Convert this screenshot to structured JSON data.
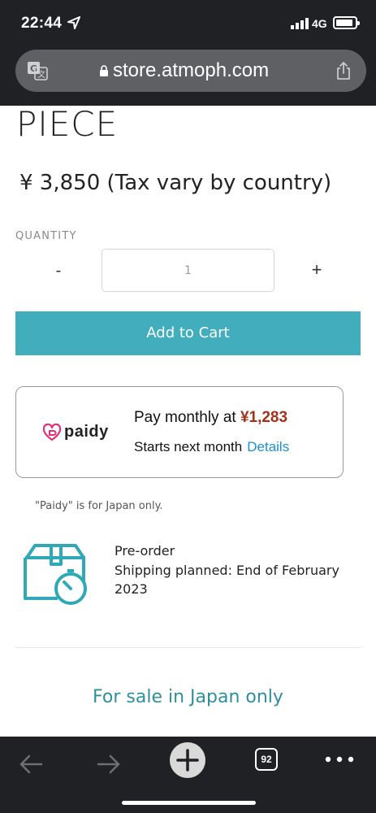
{
  "status_bar": {
    "time": "22:44",
    "network": "4G"
  },
  "browser": {
    "url": "store.atmoph.com",
    "icons": [
      "translate-icon",
      "lock-icon",
      "share-icon"
    ]
  },
  "product": {
    "title": "PIECE",
    "price": "¥ 3,850 (Tax vary by country)",
    "quantity_label": "QUANTITY",
    "quantity_minus": "-",
    "quantity_value": "1",
    "quantity_plus": "+",
    "add_to_cart": "Add to Cart"
  },
  "paidy": {
    "logo_text": "paidy",
    "pay_prefix": "Pay monthly at ",
    "pay_amount": "¥1,283",
    "starts": "Starts next month",
    "details": "Details",
    "note": "\"Paidy\" is for Japan only.",
    "amount_color": "#a4321a",
    "brand_color": "#e0307a"
  },
  "shipping": {
    "line1": "Pre-order",
    "line2": "Shipping planned: End of February",
    "line3": "2023",
    "icon": "package-timer-icon"
  },
  "sale_note": "For sale in Japan only",
  "toolbar": {
    "tab_count": "92",
    "icons": [
      "back-arrow-icon",
      "forward-arrow-icon",
      "new-tab-plus-icon",
      "tabs-icon",
      "more-dots-icon"
    ]
  },
  "colors": {
    "accent": "#42aebd",
    "link": "#1d8fd8",
    "sale_text": "#2f8f9c",
    "chrome": "#202124"
  }
}
